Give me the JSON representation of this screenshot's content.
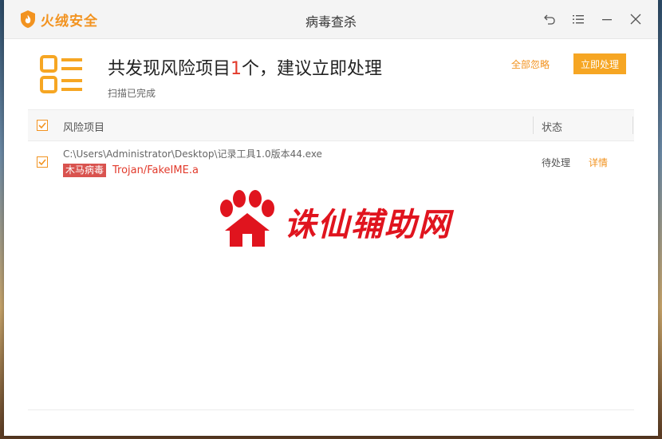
{
  "app": {
    "name": "火绒安全",
    "window_title": "病毒查杀"
  },
  "summary": {
    "title_prefix": "共发现风险项目",
    "count": "1",
    "title_suffix": "个，建议立即处理",
    "subtitle": "扫描已完成"
  },
  "actions": {
    "ignore_all": "全部忽略",
    "handle_now": "立即处理"
  },
  "table": {
    "headers": {
      "risk": "风险项目",
      "status": "状态"
    },
    "rows": [
      {
        "path": "C:\\Users\\Administrator\\Desktop\\记录工具1.0版本44.exe",
        "badge": "木马病毒",
        "virus": "Trojan/FakeIME.a",
        "status": "待处理",
        "detail": "详情"
      }
    ]
  },
  "watermark": {
    "text": "诛仙辅助网"
  },
  "colors": {
    "accent": "#f29320",
    "button": "#f6a623",
    "danger": "#e23a2b",
    "badge": "#d9534f"
  },
  "icons": [
    "fire-shield-logo-icon",
    "back-icon",
    "menu-icon",
    "minimize-icon",
    "close-icon",
    "list-report-icon",
    "checkbox-checked-icon",
    "paw-house-icon"
  ]
}
